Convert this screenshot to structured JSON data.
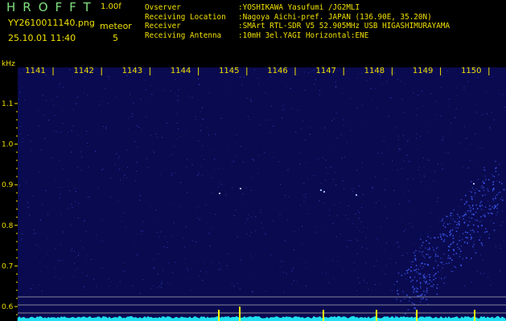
{
  "header": {
    "app_title": "HROFFT",
    "version": "1.00f",
    "filename": "YY2610011140.png",
    "datetime": "25.10.01 11:40",
    "detection_label": "meteor",
    "detection_count": "5"
  },
  "info": [
    {
      "key": "Ovserver",
      "value": ":YOSHIKAWA Yasufumi /JG2MLI"
    },
    {
      "key": "Receiving Location",
      "value": ":Nagoya Aichi-pref. JAPAN (136.90E, 35.20N)"
    },
    {
      "key": "Receiver",
      "value": ":SMArt RTL-SDR V5 52.905MHz USB HIGASHIMURAYAMA"
    },
    {
      "key": "Receiving Antenna",
      "value": ":10mH 3el.YAGI Horizontal:ENE"
    }
  ],
  "spectrogram": {
    "y_unit": "kHz",
    "y_ticks": [
      "1.1",
      "1.0",
      "0.9",
      "0.8",
      "0.7",
      "0.6"
    ],
    "time_labels": [
      "1141",
      "1142",
      "1143",
      "1144",
      "1145",
      "1146",
      "1147",
      "1148",
      "1149",
      "1150"
    ],
    "colors": {
      "background": "#0a0a50",
      "signal": "#4060ff",
      "axis_text": "#f0e000",
      "tick": "#f0e000",
      "marker": "#ffff00",
      "noise_floor": "#20e0f0",
      "reference_line": "#b0b0b0"
    }
  }
}
